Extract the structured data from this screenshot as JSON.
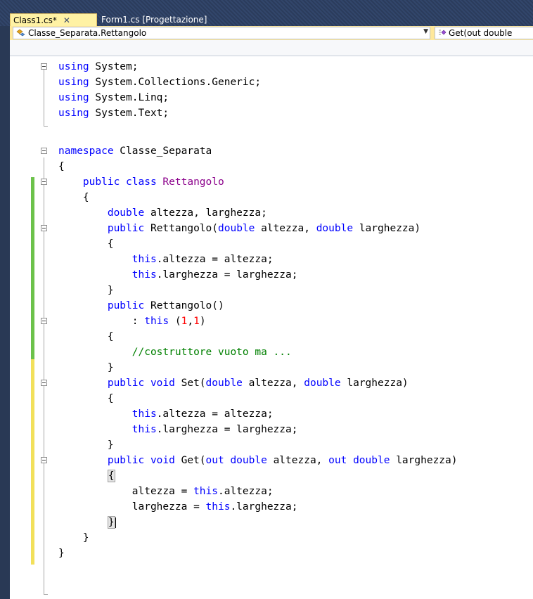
{
  "tabs": [
    {
      "label": "Class1.cs*",
      "close": "✕",
      "active": true
    },
    {
      "label": "Form1.cs [Progettazione]",
      "active": false
    }
  ],
  "navbar": {
    "type_selector": "Classe_Separata.Rettangolo",
    "type_icon": "class-icon",
    "member_selector": "Get(out double",
    "member_icon": "method-icon"
  },
  "colors": {
    "keyword": "#0000ff",
    "type": "#2b91af",
    "class_name": "#8b008b",
    "comment": "#008000",
    "number": "#ff0000",
    "saved_change_bar": "#6cc24a",
    "unsaved_change_bar": "#f2e05a"
  },
  "code": {
    "l1": "using System;",
    "l2": "using System.Collections.Generic;",
    "l3": "using System.Linq;",
    "l4": "using System.Text;",
    "l6": "namespace Classe_Separata",
    "l7": "{",
    "l8_kw": "public class ",
    "l8_name": "Rettangolo",
    "l9": "{",
    "l10_kw": "double",
    "l10_rest": " altezza, larghezza;",
    "l11_kw": "public",
    "l11_a": " Rettangolo(",
    "l11_t1": "double",
    "l11_b": " altezza, ",
    "l11_t2": "double",
    "l11_c": " larghezza)",
    "l12": "{",
    "l13_kw": "this",
    "l13_rest": ".altezza = altezza;",
    "l14_kw": "this",
    "l14_rest": ".larghezza = larghezza;",
    "l15": "}",
    "l16_kw": "public",
    "l16_rest": " Rettangolo()",
    "l17_a": ": ",
    "l17_kw": "this",
    "l17_b": " (",
    "l17_n1": "1",
    "l17_c": ",",
    "l17_n2": "1",
    "l17_d": ")",
    "l18": "{",
    "l19": "//costruttore vuoto ma ...",
    "l20": "}",
    "l21_kw": "public void",
    "l21_a": " Set(",
    "l21_t1": "double",
    "l21_b": " altezza, ",
    "l21_t2": "double",
    "l21_c": " larghezza)",
    "l22": "{",
    "l23_kw": "this",
    "l23_rest": ".altezza = altezza;",
    "l24_kw": "this",
    "l24_rest": ".larghezza = larghezza;",
    "l25": "}",
    "l26_kw": "public void",
    "l26_a": " Get(",
    "l26_k2": "out double",
    "l26_b": " altezza, ",
    "l26_k3": "out double",
    "l26_c": " larghezza)",
    "l27": "{",
    "l28_a": "altezza = ",
    "l28_kw": "this",
    "l28_b": ".altezza;",
    "l29_a": "larghezza = ",
    "l29_kw": "this",
    "l29_b": ".larghezza;",
    "l30": "}",
    "l31": "}",
    "l32": "}"
  }
}
